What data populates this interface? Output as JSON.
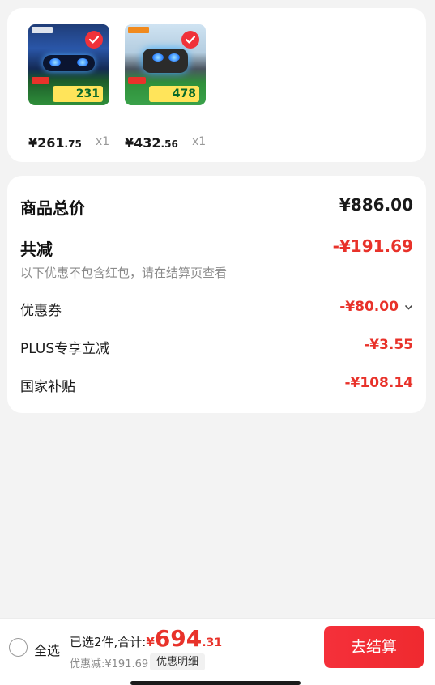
{
  "products": [
    {
      "price_yen": "¥261",
      "price_cents": ".75",
      "quantity": "x1",
      "thumb_promo": "231",
      "selected": true
    },
    {
      "price_yen": "¥432",
      "price_cents": ".56",
      "quantity": "x1",
      "thumb_promo": "478",
      "selected": true
    }
  ],
  "summary": {
    "total_label": "商品总价",
    "total_value": "¥886.00",
    "reduce_label": "共减",
    "reduce_value": "-¥191.69",
    "reduce_note": "以下优惠不包含红包，请在结算页查看",
    "items": [
      {
        "label": "优惠券",
        "value": "-¥80.00"
      },
      {
        "label": "PLUS专享立减",
        "value": "-¥3.55"
      },
      {
        "label": "国家补贴",
        "value": "-¥108.14"
      }
    ]
  },
  "bottom": {
    "select_all": "全选",
    "selected_text": "已选2件,合计:",
    "currency": "¥",
    "total_int": "694",
    "total_dec": ".31",
    "discount_text": "优惠减:¥191.69",
    "detail_button": "优惠明细",
    "checkout_button": "去结算"
  },
  "colors": {
    "accent_red": "#e8322a",
    "background": "#f3f3f3"
  }
}
